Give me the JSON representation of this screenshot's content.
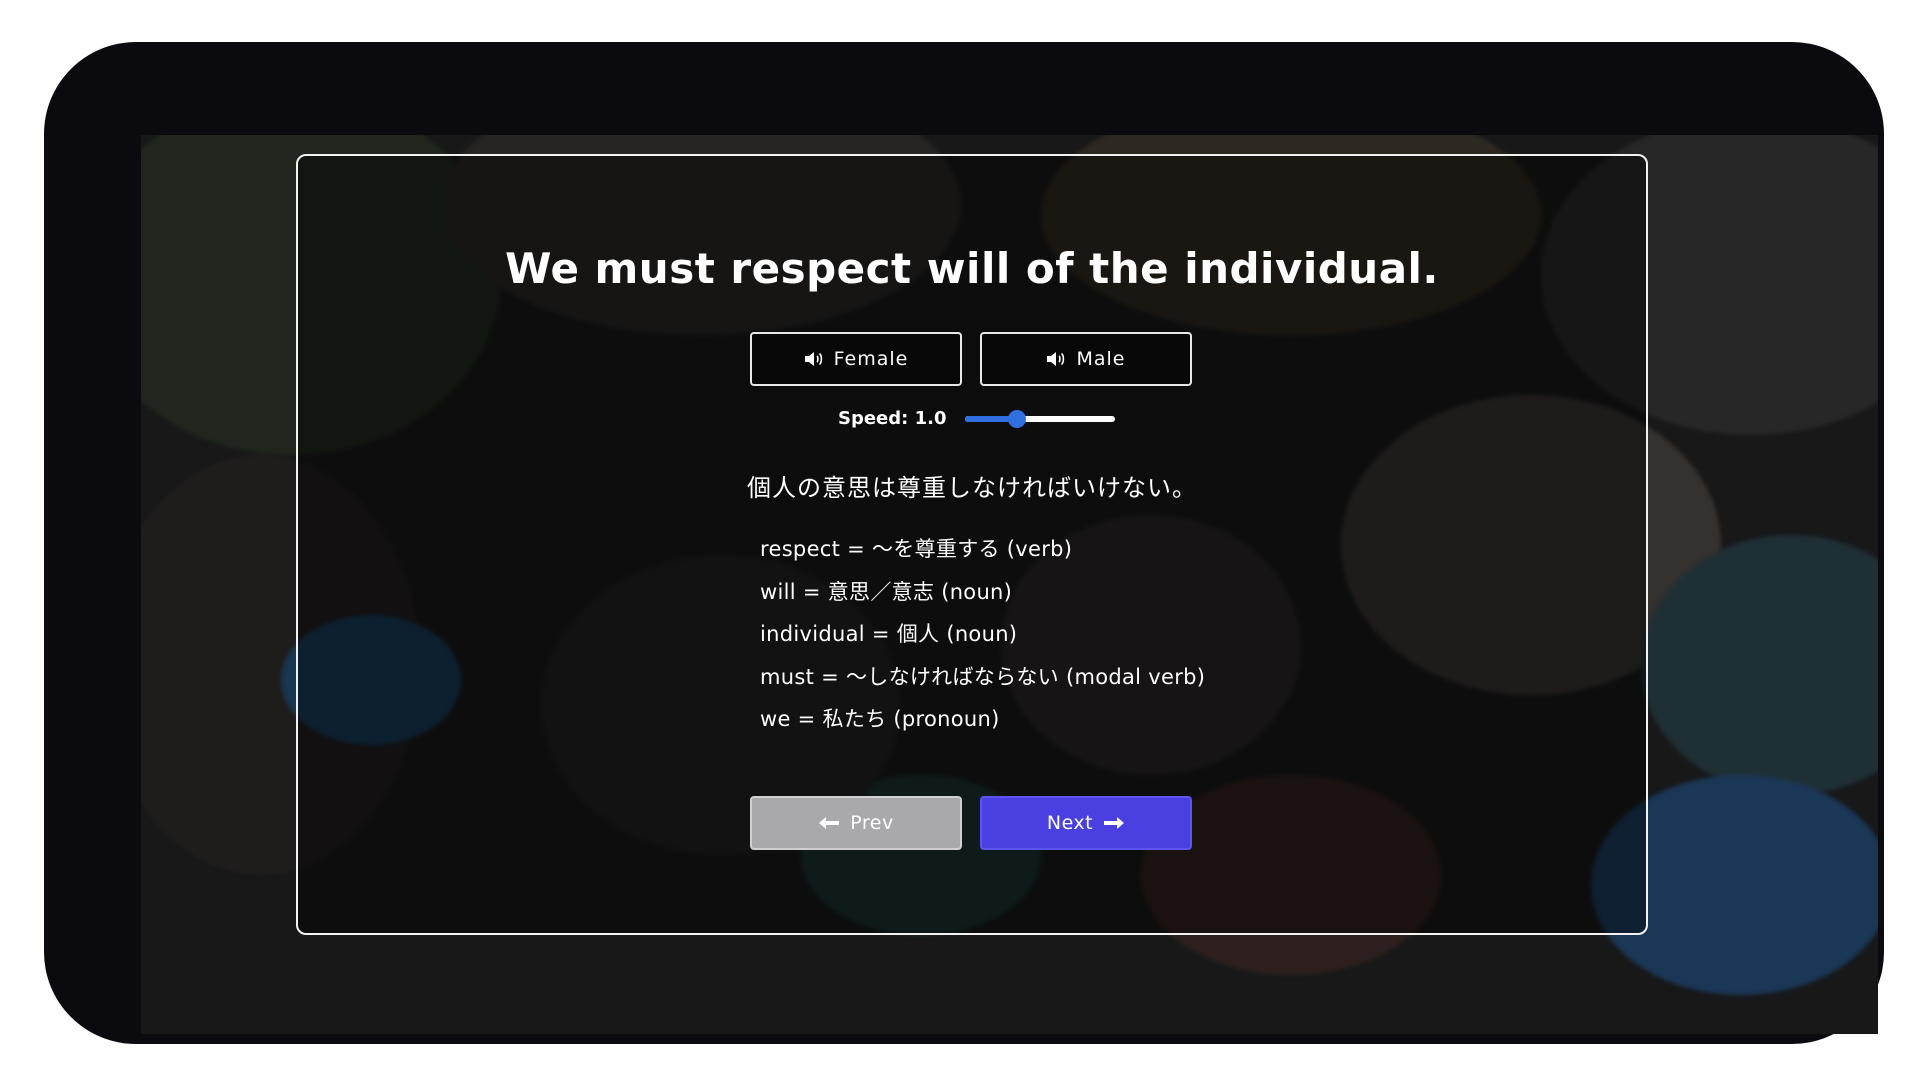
{
  "lesson": {
    "sentence": "We must respect will of the individual.",
    "translation": "個人の意思は尊重しなければいけない。",
    "vocabulary": [
      "respect = ～を尊重する (verb)",
      "will = 意思／意志 (noun)",
      "individual = 個人 (noun)",
      "must = ～しなければならない (modal verb)",
      "we = 私たち (pronoun)"
    ]
  },
  "audio": {
    "female_label": "Female",
    "male_label": "Male",
    "speed_label": "Speed: 1.0",
    "speed_value": 1.0,
    "speed_fraction": 0.35
  },
  "navigation": {
    "prev_label": "Prev",
    "next_label": "Next"
  },
  "colors": {
    "accent": "#4a3fe0",
    "slider": "#2f6fe0",
    "prev_button": "#a9a9ab"
  },
  "icons": {
    "voice": "speaker-icon",
    "prev": "arrow-left-icon",
    "next": "arrow-right-icon"
  }
}
